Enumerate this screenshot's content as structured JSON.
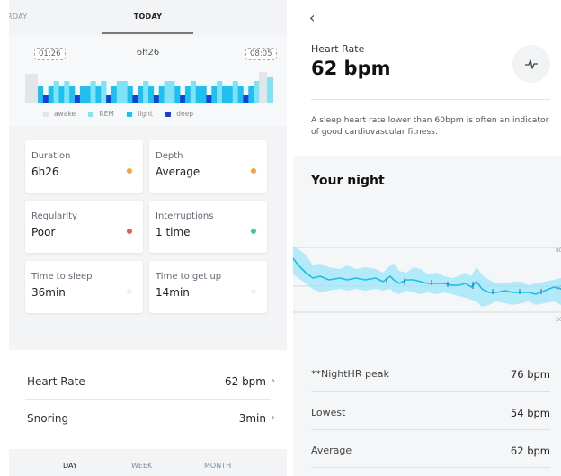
{
  "left": {
    "tabs": {
      "yesterday": "RDAY",
      "today": "TODAY"
    },
    "sleep": {
      "start": "01:26",
      "end": "08:05",
      "total": "6h26",
      "legend": [
        {
          "label": "awake",
          "color": "#e3e5e8"
        },
        {
          "label": "REM",
          "color": "#7fe3f5"
        },
        {
          "label": "light",
          "color": "#1ec0ef"
        },
        {
          "label": "deep",
          "color": "#1b3fd1"
        }
      ]
    },
    "metrics": [
      {
        "label": "Duration",
        "value": "6h26",
        "dot": "#f4a53a"
      },
      {
        "label": "Depth",
        "value": "Average",
        "dot": "#f4a53a"
      },
      {
        "label": "Regularity",
        "value": "Poor",
        "dot": "#ea5a5a"
      },
      {
        "label": "Interruptions",
        "value": "1 time",
        "dot": "#3ccf8a"
      },
      {
        "label": "Time to sleep",
        "value": "36min",
        "dot": "#f1f1f1"
      },
      {
        "label": "Time to get up",
        "value": "14min",
        "dot": "#f1f1f1"
      }
    ],
    "list": [
      {
        "label": "Heart Rate",
        "value": "62 bpm",
        "chevron": "›"
      },
      {
        "label": "Snoring",
        "value": "3min",
        "chevron": "›"
      }
    ],
    "nav": {
      "day": "DAY",
      "week": "WEEK",
      "month": "MONTH"
    }
  },
  "right": {
    "back": "‹",
    "title": "Heart Rate",
    "value": "62 bpm",
    "description": "A sleep heart rate lower than 60bpm is often an indicator of good cardiovascular fitness.",
    "night_title": "Your night",
    "axis": {
      "top": "80",
      "mid": "60",
      "bottom": "50"
    },
    "stats": [
      {
        "label": "**NightHR peak",
        "value": "76 bpm"
      },
      {
        "label": "Lowest",
        "value": "54 bpm"
      },
      {
        "label": "Average",
        "value": "62 bpm"
      }
    ]
  }
}
